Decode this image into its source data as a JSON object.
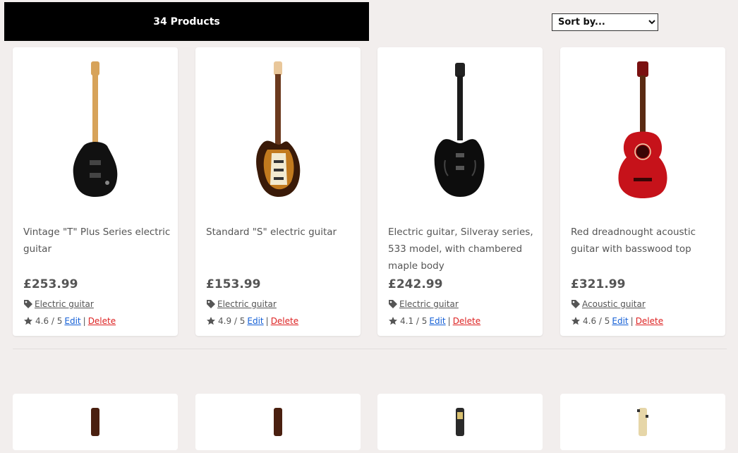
{
  "header": {
    "count_label": "34 Products",
    "sort_placeholder": "Sort by..."
  },
  "products": [
    {
      "title": "Vintage \"T\" Plus Series electric guitar",
      "price": "£253.99",
      "category": "Electric guitar",
      "rating": "4.6 / 5",
      "edit": "Edit",
      "delete": "Delete"
    },
    {
      "title": "Standard \"S\" electric guitar",
      "price": "£153.99",
      "category": "Electric guitar",
      "rating": "4.9 / 5",
      "edit": "Edit",
      "delete": "Delete"
    },
    {
      "title": "Electric guitar, Silveray series, 533 model, with chambered maple body",
      "price": "£242.99",
      "category": "Electric guitar",
      "rating": "4.1 / 5",
      "edit": "Edit",
      "delete": "Delete"
    },
    {
      "title": "Red dreadnought acoustic guitar with basswood top",
      "price": "£321.99",
      "category": "Acoustic guitar",
      "rating": "4.6 / 5",
      "edit": "Edit",
      "delete": "Delete"
    }
  ],
  "separator": "|",
  "colors": {
    "edit_link": "#1560d6",
    "delete_link": "#dd2222",
    "count_bar": "#000000",
    "page_bg": "#f2eeed"
  },
  "icons": {
    "category": "tag-icon",
    "rating": "star-icon"
  }
}
